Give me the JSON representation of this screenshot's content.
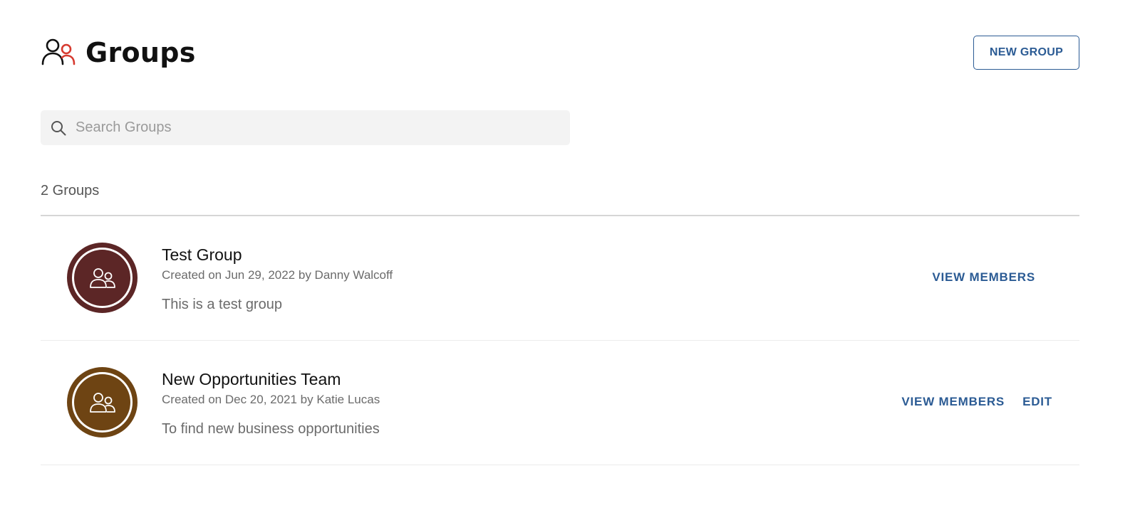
{
  "header": {
    "title": "Groups",
    "icon": "people-icon",
    "new_group_label": "NEW GROUP"
  },
  "search": {
    "placeholder": "Search Groups",
    "value": ""
  },
  "list": {
    "count_label": "2 Groups",
    "groups": [
      {
        "name": "Test Group",
        "meta": "Created on Jun 29, 2022 by Danny Walcoff",
        "description": "This is a test group",
        "avatar_color": "#5c2626",
        "actions": [
          "VIEW MEMBERS"
        ]
      },
      {
        "name": "New Opportunities Team",
        "meta": "Created on Dec 20, 2021 by Katie Lucas",
        "description": "To find new business opportunities",
        "avatar_color": "#6e4413",
        "actions": [
          "VIEW MEMBERS",
          "EDIT"
        ]
      }
    ]
  },
  "colors": {
    "accent": "#2b5b94",
    "header_icon_primary": "#111111",
    "header_icon_secondary": "#d63a2f",
    "search_bg": "#f3f3f3"
  }
}
